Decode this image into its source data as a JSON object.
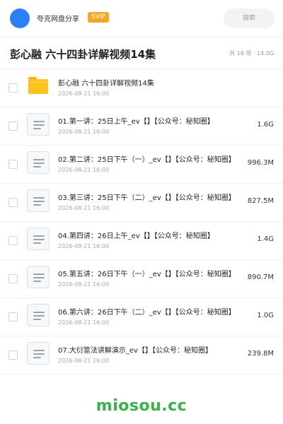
{
  "header": {
    "share_name": "夸克网盘分享",
    "badge": "SVIP",
    "search_placeholder": "搜索"
  },
  "title_bar": {
    "title": "彭心融 六十四卦详解视频14集",
    "summary": "共 18 项 · 14.0G"
  },
  "files": [
    {
      "type": "folder",
      "name": "彭心融 六十四卦详解视频14集",
      "date": "2026-08-21 16:00",
      "size": ""
    },
    {
      "type": "video",
      "name": "01.第一讲：25日上午_ev【】【公众号：秘知圈】",
      "date": "2026-08-21 16:00",
      "size": "1.6G"
    },
    {
      "type": "video",
      "name": "02.第二讲：25日下午（一）_ev【】【公众号：秘知圈】",
      "date": "2026-08-21 16:00",
      "size": "996.3M"
    },
    {
      "type": "video",
      "name": "03.第三讲：25日下午（二）_ev【】【公众号：秘知圈】",
      "date": "2026-08-21 16:00",
      "size": "827.5M"
    },
    {
      "type": "video",
      "name": "04.第四讲：26日上午_ev【】【公众号：秘知圈】",
      "date": "2026-08-21 16:00",
      "size": "1.4G"
    },
    {
      "type": "video",
      "name": "05.第五讲：26日下午（一）_ev【】【公众号：秘知圈】",
      "date": "2026-08-21 16:00",
      "size": "890.7M"
    },
    {
      "type": "video",
      "name": "06.第六讲：26日下午（二）_ev【】【公众号：秘知圈】",
      "date": "2026-08-21 16:00",
      "size": "1.0G"
    },
    {
      "type": "video",
      "name": "07.大衍筮法讲解演示_ev【】【公众号：秘知圈】",
      "date": "2026-08-21 16:00",
      "size": "239.8M"
    }
  ],
  "watermark": "miosou.cc",
  "colors": {
    "avatar": "#2d7ff9",
    "badge": "#f5a623",
    "folder": "#ffc21b",
    "watermark": "#37b34a"
  }
}
